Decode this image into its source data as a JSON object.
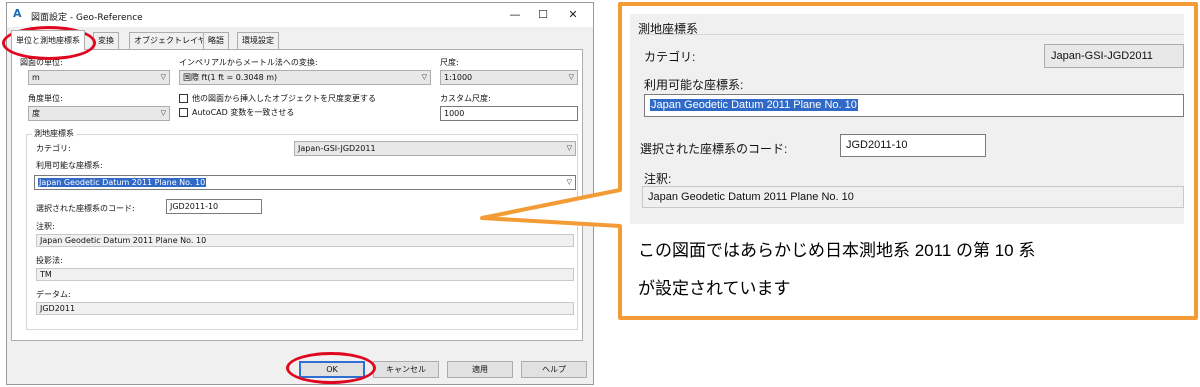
{
  "window": {
    "title": "図面設定 - Geo-Reference",
    "app_icon": "A",
    "minimize_glyph": "—",
    "maximize_glyph": "☐",
    "close_glyph": "✕"
  },
  "tabs": [
    {
      "label": "単位と測地座標系"
    },
    {
      "label": "変換"
    },
    {
      "label": "オブジェクトレイヤ"
    },
    {
      "label": "略語"
    },
    {
      "label": "環境設定"
    }
  ],
  "units": {
    "drawing_units_label": "図面の単位:",
    "drawing_units_value": "m",
    "imperial_label": "インペリアルからメートル法への変換:",
    "imperial_value": "国際 ft(1 ft = 0.3048 m)",
    "scale_label": "尺度:",
    "scale_value": "1:1000",
    "angle_label": "角度単位:",
    "angle_value": "度",
    "scale_objects_label": "他の図面から挿入したオブジェクトを尺度変更する",
    "autocad_vars_label": "AutoCAD 変数を一致させる",
    "custom_scale_label": "カスタム尺度:",
    "custom_scale_value": "1000"
  },
  "coordsys": {
    "group_label": "測地座標系",
    "category_label": "カテゴリ:",
    "category_value": "Japan-GSI-JGD2011",
    "available_label": "利用可能な座標系:",
    "available_value": "Japan Geodetic Datum 2011 Plane No. 10",
    "code_label": "選択された座標系のコード:",
    "code_value": "JGD2011-10",
    "note_label": "注釈:",
    "note_value": "Japan Geodetic Datum 2011 Plane No. 10",
    "projection_label": "投影法:",
    "projection_value": "TM",
    "datum_label": "データム:",
    "datum_value": "JGD2011"
  },
  "buttons": {
    "ok": "OK",
    "cancel": "キャンセル",
    "apply": "適用",
    "help": "ヘルプ"
  },
  "zoom": {
    "group_label": "測地座標系",
    "category_label": "カテゴリ:",
    "category_value": "Japan-GSI-JGD2011",
    "available_label": "利用可能な座標系:",
    "available_value": "Japan Geodetic Datum 2011 Plane No. 10",
    "code_label": "選択された座標系のコード:",
    "code_value": "JGD2011-10",
    "note_label": "注釈:",
    "note_value": "Japan Geodetic Datum 2011 Plane No. 10"
  },
  "caption": {
    "line1": "この図面ではあらかじめ日本測地系 2011 の第 10 系",
    "line2": "が設定されています"
  },
  "colors": {
    "callout_border": "#f39c35",
    "highlight_oval": "#e0061f",
    "selection": "#3169c6"
  }
}
